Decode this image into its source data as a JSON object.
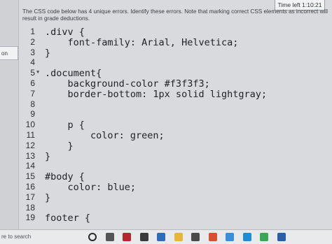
{
  "timer": {
    "label": "Time left 1:10:21"
  },
  "left_panel": {
    "tab_label": "on"
  },
  "question": {
    "text": "The CSS code below has 4 unique errors. Identify these errors. Note that marking correct CSS elements as incorrect will result in grade deductions."
  },
  "code_lines": [
    {
      "n": "1",
      "text": ".divv {"
    },
    {
      "n": "2",
      "text": "    font-family: Arial, Helvetica;"
    },
    {
      "n": "3",
      "text": "}"
    },
    {
      "n": "4",
      "text": ""
    },
    {
      "n": "5",
      "text": ".document{",
      "fold": "▼"
    },
    {
      "n": "6",
      "text": "    background-color #f3f3f3;"
    },
    {
      "n": "7",
      "text": "    border-bottom: 1px solid lightgray;"
    },
    {
      "n": "8",
      "text": ""
    },
    {
      "n": "9",
      "text": ""
    },
    {
      "n": "10",
      "text": "    p {"
    },
    {
      "n": "11",
      "text": "        color: green;"
    },
    {
      "n": "12",
      "text": "    }"
    },
    {
      "n": "13",
      "text": "}"
    },
    {
      "n": "14",
      "text": ""
    },
    {
      "n": "15",
      "text": "#body {"
    },
    {
      "n": "16",
      "text": "    color: blue;"
    },
    {
      "n": "17",
      "text": "}"
    },
    {
      "n": "18",
      "text": ""
    },
    {
      "n": "19",
      "text": "footer {"
    }
  ],
  "taskbar": {
    "search_placeholder": "re to search",
    "icons": [
      {
        "name": "cortana-circle-icon",
        "color": "#2a2a2a"
      },
      {
        "name": "task-view-icon",
        "color": "#555555"
      },
      {
        "name": "app-red-icon",
        "color": "#b8252c"
      },
      {
        "name": "store-bag-icon",
        "color": "#3a3a3a"
      },
      {
        "name": "mail-icon",
        "color": "#2f6db5"
      },
      {
        "name": "folder-icon",
        "color": "#e7b53a"
      },
      {
        "name": "gamepad-icon",
        "color": "#4a4a4a"
      },
      {
        "name": "media-icon",
        "color": "#d5502f"
      },
      {
        "name": "photos-icon",
        "color": "#3a8fd8"
      },
      {
        "name": "edge-icon",
        "color": "#1f8dd6"
      },
      {
        "name": "chrome-icon",
        "color": "#3aa757"
      },
      {
        "name": "calculator-icon",
        "color": "#2a5ea8"
      }
    ]
  }
}
